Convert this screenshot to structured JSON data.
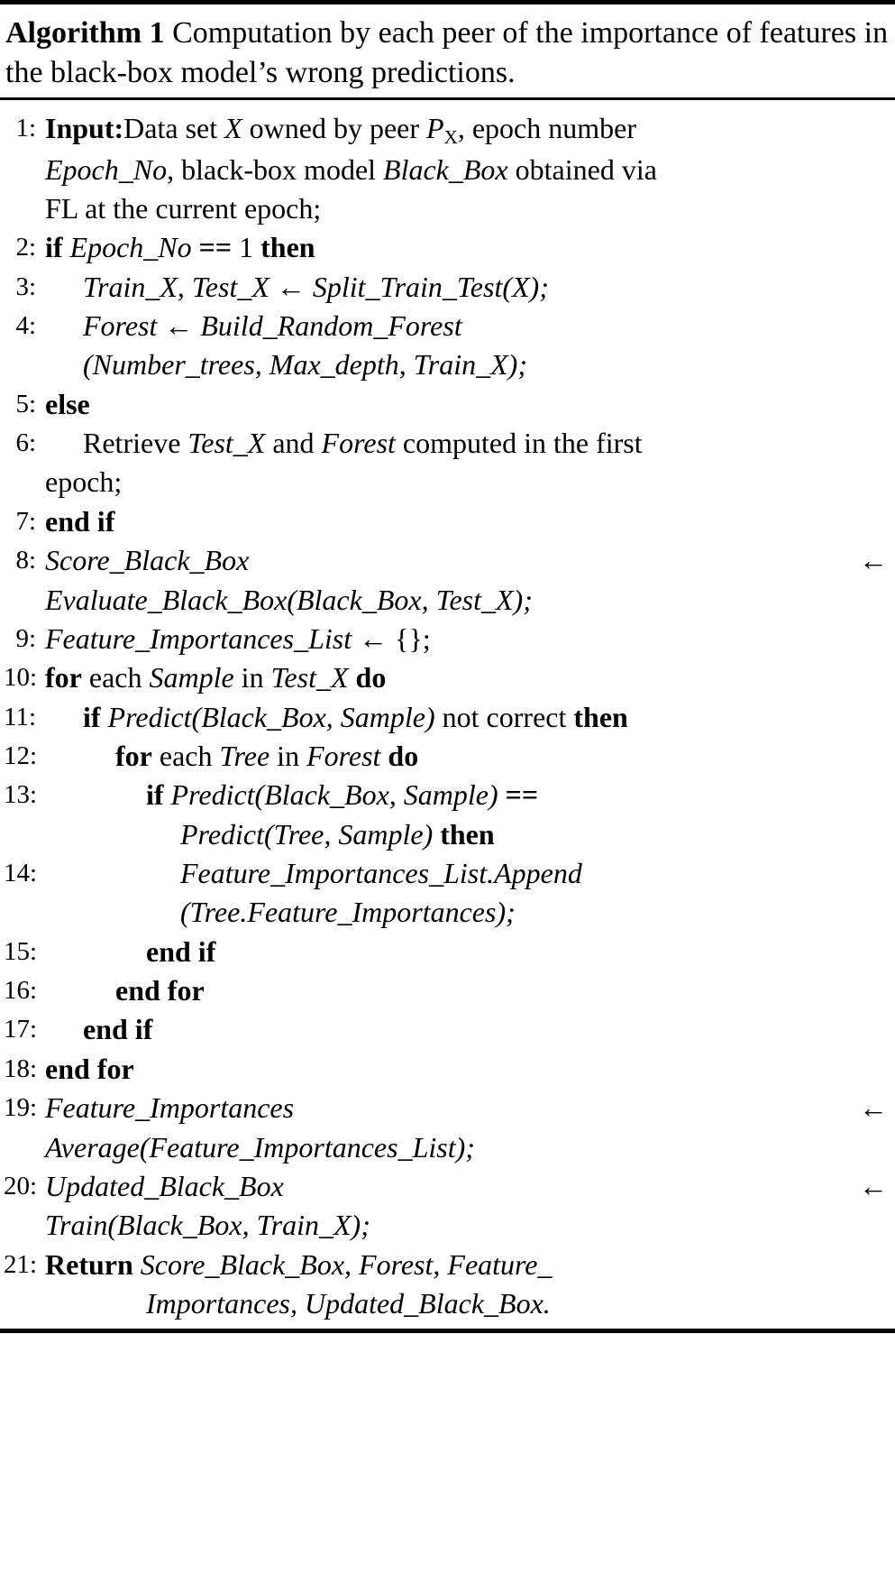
{
  "figure": {
    "label": "Algorithm 1",
    "caption": "Computation by each peer of the importance of features in the black-box model’s wrong predictions."
  },
  "symbols": {
    "assign_arrow": "←",
    "equals_equals": "==",
    "empty_set_literal": "{};"
  },
  "lines": {
    "n1": "1:",
    "n2": "2:",
    "n3": "3:",
    "n4": "4:",
    "n5": "5:",
    "n6": "6:",
    "n7": "7:",
    "n8": "8:",
    "n9": "9:",
    "n10": "10:",
    "n11": "11:",
    "n12": "12:",
    "n13": "13:",
    "n14": "14:",
    "n15": "15:",
    "n16": "16:",
    "n17": "17:",
    "n18": "18:",
    "n19": "19:",
    "n20": "20:",
    "n21": "21:"
  },
  "l1": {
    "kw_input": "Input:",
    "t1": "Data set ",
    "v_X": "X",
    "t2": " owned by peer ",
    "v_P": "P",
    "v_P_sub": "X",
    "t3": ", epoch number",
    "c_v_epochno": "Epoch_No",
    "c_t1": ", black-box model ",
    "c_v_blackbox": "Black_Box",
    "c_t2": " obtained via",
    "c2_t": "FL at the current epoch;"
  },
  "l2": {
    "kw_if": "if",
    "v_epochno": "Epoch_No",
    "op": "==",
    "num": "1",
    "kw_then": "then"
  },
  "l3": {
    "v_trainx": "Train_X",
    "comma": ", ",
    "v_testx": "Test_X",
    "arrow": "←",
    "v_split": "Split_Train_Test",
    "args": "(X);"
  },
  "l4": {
    "v_forest": "Forest",
    "arrow": "←",
    "v_build": "Build_Random_Forest",
    "c_open": "(",
    "c_v1": "Number_trees",
    "c_c1": ", ",
    "c_v2": "Max_depth",
    "c_c2": ", ",
    "c_v3": "Train_X",
    "c_close": ");"
  },
  "l5": {
    "kw_else": "else"
  },
  "l6": {
    "t1": "Retrieve ",
    "v_testx": "Test_X",
    "t2": " and ",
    "v_forest": "Forest",
    "t3": " computed in the first",
    "c_t": "epoch;"
  },
  "l7": {
    "kw_endif": "end if"
  },
  "l8": {
    "v_score": "Score_Black_Box",
    "arrow": "←",
    "c_v_eval": "Evaluate_Black_Box",
    "c_open": "(",
    "c_v1": "Black_Box",
    "c_c1": ", ",
    "c_v2": "Test_X",
    "c_close": ");"
  },
  "l9": {
    "v_fil": "Feature_Importances_List",
    "arrow": "←",
    "lit": "{};"
  },
  "l10": {
    "kw_for": "for",
    "t1": " each ",
    "v_sample": "Sample",
    "t2": " in ",
    "v_testx": "Test_X",
    "kw_do": "do"
  },
  "l11": {
    "kw_if": "if",
    "v_predict": "Predict",
    "open": "(",
    "v1": "Black_Box",
    "c1": ", ",
    "v2": "Sample",
    "close": ")",
    "t1": " not correct ",
    "kw_then": "then"
  },
  "l12": {
    "kw_for": "for",
    "t1": " each ",
    "v_tree": "Tree",
    "t2": " in ",
    "v_forest": "Forest",
    "kw_do": "do"
  },
  "l13": {
    "kw_if": "if",
    "v_predict": "Predict",
    "open": "(",
    "v1": "Black_Box",
    "c1": ", ",
    "v2": "Sample",
    "close": ")",
    "op": "==",
    "c_v_predict": "Predict",
    "c_open": "(",
    "c_v1": "Tree",
    "c_c1": ", ",
    "c_v2": "Sample",
    "c_close": ")",
    "kw_then": "then"
  },
  "l14": {
    "v_call": "Feature_Importances_List.Append",
    "c_open": "(",
    "c_v": "Tree.Feature_Importances",
    "c_close": ");"
  },
  "l15": {
    "kw_endif": "end if"
  },
  "l16": {
    "kw_endfor": "end for"
  },
  "l17": {
    "kw_endif": "end if"
  },
  "l18": {
    "kw_endfor": "end for"
  },
  "l19": {
    "v_fi": "Feature_Importances",
    "arrow": "←",
    "c_v_avg": "Average",
    "c_open": "(",
    "c_v1": "Feature_Importances_List",
    "c_close": ");"
  },
  "l20": {
    "v_ubb": "Updated_Black_Box",
    "arrow": "←",
    "c_v_train": "Train",
    "c_open": "(",
    "c_v1": "Black_Box",
    "c_c1": ", ",
    "c_v2": "Train_X",
    "c_close": ");"
  },
  "l21": {
    "kw_return": "Return",
    "v1": "Score_Black_Box",
    "c1": ", ",
    "v2": "Forest",
    "c2": ", ",
    "v3": "Feature_",
    "c_v4": "Importances",
    "c_c3": ", ",
    "c_v5": "Updated_Black_Box",
    "c_period": "."
  }
}
